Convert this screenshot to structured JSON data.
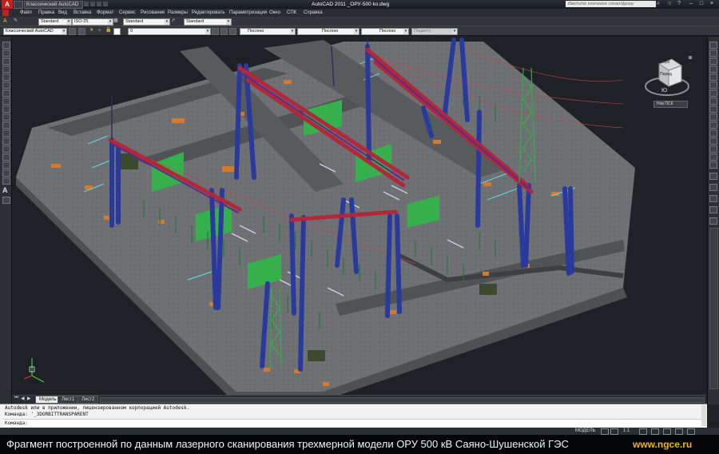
{
  "titlebar": {
    "workspace": "Классический AutoCAD",
    "window_title": "AutoCAD 2011    _ОРУ-500 ko.dwg",
    "search_placeholder": "Введите ключевое слово/фразу"
  },
  "menu": [
    "Файл",
    "Правка",
    "Вид",
    "Вставка",
    "Формат",
    "Сервис",
    "Рисование",
    "Размеры",
    "Редактировать",
    "Параметризация",
    "Окно",
    "СПК",
    "Справка"
  ],
  "toolbar1": {
    "text_style": "Standard",
    "dim_style": "ISO-25",
    "table_style": "Standard",
    "mleader_style": "Standard"
  },
  "toolbar2": {
    "workspace": "Классический AutoCAD",
    "layer": "0",
    "color": "Послою",
    "linetype": "Послою",
    "lineweight": "Послою",
    "plotstyle": "Поцвету"
  },
  "viewcube": {
    "top_label": "Верх",
    "front_label": "Перед",
    "compass_s": "Ю",
    "wcs_label": "Нов ПСК"
  },
  "tabs": [
    "Модель",
    "Лист1",
    "Лист2"
  ],
  "command_history": [
    "Autodesk или в приложении, лицензированном корпорацией Autodesk.",
    "Команда: '_3DORBITTRANSPARENT"
  ],
  "command_prompt": "Команда:",
  "statusbar": {
    "mode": "МОДЕЛЬ",
    "scale": "1:1"
  },
  "caption": {
    "text": "Фрагмент построенной по данным лазерного сканирования трехмерной модели ОРУ 500 кВ Саяно-Шушенской ГЭС",
    "site": "www.ngce.ru",
    "site_color": "#f0b21a"
  },
  "colors": {
    "background": "#1f2126",
    "ground": "#6e7074",
    "structure_blue": "#2a3a9c",
    "beam_red": "#b0283a",
    "equipment_green": "#2fb04a",
    "foundation_orange": "#d27a2e"
  }
}
